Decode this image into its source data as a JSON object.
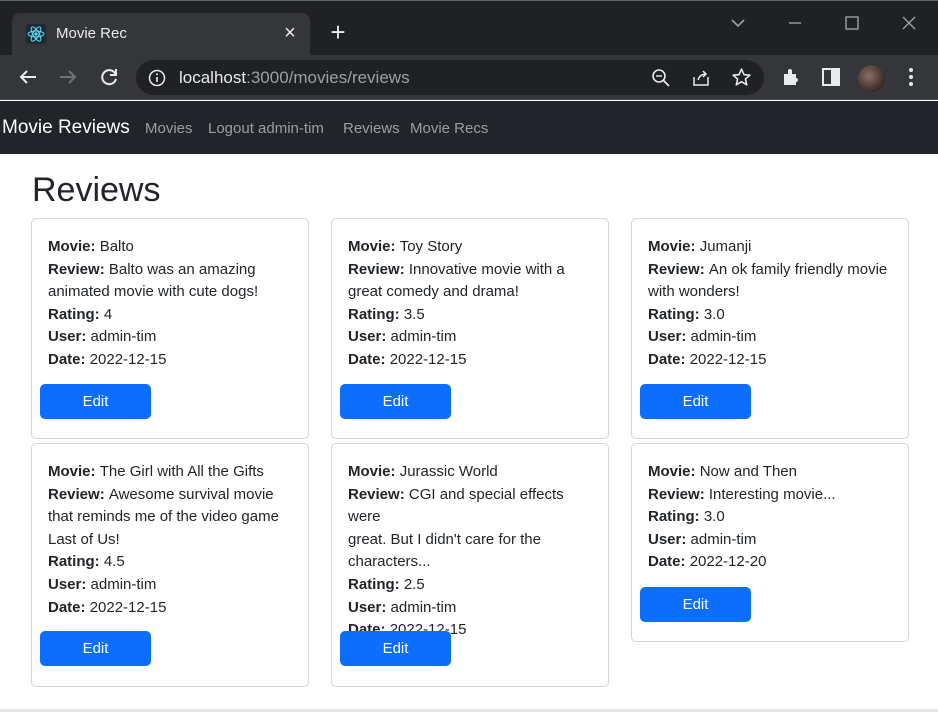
{
  "browser": {
    "tab_title": "Movie Rec",
    "url_host": "localhost",
    "url_path": ":3000/movies/reviews"
  },
  "nav": {
    "brand": "Movie Reviews",
    "links": [
      "Movies",
      "Logout admin-tim",
      "Reviews",
      "Movie Recs"
    ]
  },
  "page": {
    "title": "Reviews"
  },
  "labels": {
    "movie": "Movie:",
    "review": "Review:",
    "rating": "Rating:",
    "user": "User:",
    "date": "Date:",
    "edit": "Edit"
  },
  "reviews": [
    {
      "movie": "Balto",
      "review_lines": [
        "Balto was an amazing",
        "animated movie with cute dogs!"
      ],
      "rating": "4",
      "user": "admin-tim",
      "date": "2022-12-15"
    },
    {
      "movie": "Toy Story",
      "review_lines": [
        "Innovative movie with a",
        "great comedy and drama!"
      ],
      "rating": "3.5",
      "user": "admin-tim",
      "date": "2022-12-15"
    },
    {
      "movie": "Jumanji",
      "review_lines": [
        "An ok family friendly movie",
        "with wonders!"
      ],
      "rating": "3.0",
      "user": "admin-tim",
      "date": "2022-12-15"
    },
    {
      "movie": "The Girl with All the Gifts",
      "review_lines": [
        "Awesome survival movie",
        "that reminds me of the video game",
        "Last of Us!"
      ],
      "rating": "4.5",
      "user": "admin-tim",
      "date": "2022-12-15"
    },
    {
      "movie": "Jurassic World",
      "review_lines": [
        "CGI and special effects were",
        "great. But I didn't care for the",
        "characters..."
      ],
      "rating": "2.5",
      "user": "admin-tim",
      "date": "2022-12-15"
    },
    {
      "movie": "Now and Then",
      "review_lines": [
        "Interesting movie..."
      ],
      "rating": "3.0",
      "user": "admin-tim",
      "date": "2022-12-20"
    }
  ],
  "colors": {
    "primary": "#0d6efd",
    "navbar": "#212529",
    "chrome": "#202124"
  }
}
